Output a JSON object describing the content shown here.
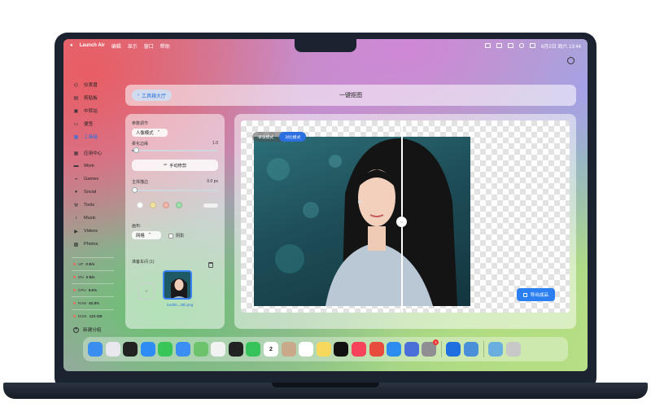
{
  "menubar": {
    "app_name": "Launch Air",
    "menus": [
      "编辑",
      "显示",
      "窗口",
      "帮助"
    ],
    "clock": "6月2日 周六  13:44"
  },
  "sidebar": {
    "items": [
      {
        "label": "仪表盘",
        "icon": "gauge-icon"
      },
      {
        "label": "剪贴板",
        "icon": "clipboard-icon"
      },
      {
        "label": "中转站",
        "icon": "box-icon"
      },
      {
        "label": "便签",
        "icon": "note-icon"
      },
      {
        "label": "工具箱",
        "icon": "toolbox-icon",
        "active": true
      },
      {
        "label": "应用中心",
        "icon": "grid-icon"
      },
      {
        "label": "Work",
        "icon": "briefcase-icon"
      },
      {
        "label": "Games",
        "icon": "gamepad-icon"
      },
      {
        "label": "Social",
        "icon": "chat-icon"
      },
      {
        "label": "Tools",
        "icon": "hammer-icon"
      },
      {
        "label": "Music",
        "icon": "music-icon"
      },
      {
        "label": "Videos",
        "icon": "video-icon"
      },
      {
        "label": "Photos",
        "icon": "photo-icon"
      }
    ],
    "stats": [
      {
        "label": "UP",
        "value": "0 B/s"
      },
      {
        "label": "DN",
        "value": "0 B/s"
      },
      {
        "label": "CPU",
        "value": "9.6%"
      },
      {
        "label": "RAM",
        "value": "62.8%"
      },
      {
        "label": "DISK",
        "value": "123 GB"
      }
    ],
    "new_group": "新建分组"
  },
  "header": {
    "back_label": "工具箱大厅",
    "title": "一键抠图"
  },
  "settings": {
    "params_label": "参数调节",
    "mode_select": "人像模式",
    "feather_label": "柔化边缘",
    "feather_value": "1.0",
    "feather_level": 0.05,
    "manual_button": "手动修剪",
    "stroke_label": "主体描边",
    "stroke_value": "0.0 px",
    "stroke_level": 0.0,
    "swatch_colors": [
      "#ffffff",
      "#f3e3a0",
      "#f4b4a8",
      "#9ee0ad"
    ],
    "bg_label": "画布:",
    "bg_select": "网格",
    "shadow_label": "阴影",
    "queue_label": "准备车间 (1)",
    "queue_file": "ico0hb...29b.png"
  },
  "canvas": {
    "mode_options": [
      "单张模式",
      "对比模式"
    ],
    "mode_selected": 1,
    "export_label": "导出成品"
  },
  "colors": {
    "accent": "#2b6fe0",
    "export": "#2b7ff0"
  },
  "dock": {
    "apps": [
      {
        "icon": "finder-icon",
        "color": "#3a8ef0"
      },
      {
        "icon": "launchpad-icon",
        "color": "#e8e8ee"
      },
      {
        "icon": "infinity-icon",
        "color": "#222222"
      },
      {
        "icon": "safari-icon",
        "color": "#2f8cf5"
      },
      {
        "icon": "messages-icon",
        "color": "#38c659"
      },
      {
        "icon": "mail-icon",
        "color": "#3b8ef3"
      },
      {
        "icon": "maps-icon",
        "color": "#6cc36c"
      },
      {
        "icon": "photos-icon",
        "color": "#f2f2f2"
      },
      {
        "icon": "terminal-icon",
        "color": "#222222"
      },
      {
        "icon": "phone-icon",
        "color": "#36c35a"
      },
      {
        "icon": "calendar-icon",
        "color": "#ffffff",
        "text": "2"
      },
      {
        "icon": "contacts-icon",
        "color": "#c9a98a"
      },
      {
        "icon": "reminders-icon",
        "color": "#ffffff"
      },
      {
        "icon": "notes-icon",
        "color": "#f7d85a"
      },
      {
        "icon": "tv-icon",
        "color": "#111111"
      },
      {
        "icon": "music-app-icon",
        "color": "#f6425b"
      },
      {
        "icon": "rocket-icon",
        "color": "#e74c3c"
      },
      {
        "icon": "appstore-icon",
        "color": "#2d8cf0"
      },
      {
        "icon": "books-icon",
        "color": "#4a6fd8"
      },
      {
        "icon": "settings-app-icon",
        "color": "#8e8e93",
        "badge": "1"
      },
      {
        "icon": "xcode-icon",
        "color": "#1f6fe0"
      },
      {
        "icon": "preview-icon",
        "color": "#4a90d9"
      },
      {
        "icon": "folder-icon",
        "color": "#6aaee0"
      },
      {
        "icon": "trash-icon",
        "color": "#c8c8c8"
      }
    ]
  }
}
